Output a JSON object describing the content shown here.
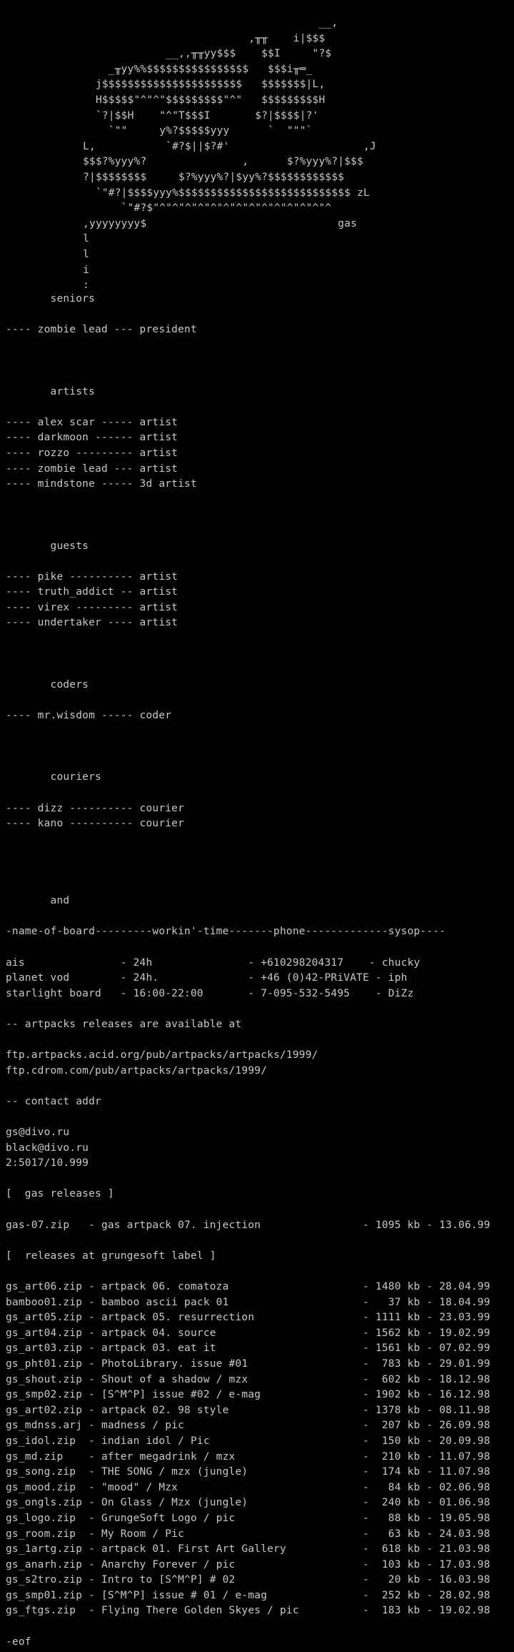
{
  "logo_art": [
    "                                                  __,",
    "                                       ,╥╥    i|$$$",
    "                          __,,╥╥yy$$$    $$I     \"?$",
    "                 _╥yy%%$$$$$$$$$$$$$$$$   $$$i╥═_",
    "               j$$$$$$$$$$$$$$$$$$$$$$   $$$$$$$|L,",
    "               H$$$$$\"^\"^\"$$$$$$$$$\"^\"   $$$$$$$$$H",
    "               `?|$$H    \"^\"T$$$I       $?|$$$$|?'",
    "                 `\"\"     y%?$$$$$yyy      `  \"\"\"`",
    "             L,           `#?$||$?#'                     ,J",
    "             $$$?%yyy%?               ,      $?%yyy%?|$$$",
    "             ?|$$$$$$$$     $?%yyy%?|$yy%?$$$$$$$$$$$$",
    "               `\"#?|$$$$yyy%$$$$$$$$$$$$$$$$$$$$$$$$$$$ zL",
    "                   `\"#?$\"^\"^\"^\"^\"^\"^\"^\"^\"^\"^\"^\"^\"^\"^",
    "             ,yyyyyyyy$                              gas",
    "             l",
    "             l",
    "             i",
    "             :"
  ],
  "sections": {
    "seniors_heading": "       seniors",
    "seniors": [
      "---- zombie lead --- president"
    ],
    "artists_heading": "       artists",
    "artists": [
      "---- alex scar ----- artist",
      "---- darkmoon ------ artist",
      "---- rozzo --------- artist",
      "---- zombie lead --- artist",
      "---- mindstone ----- 3d artist"
    ],
    "guests_heading": "       guests",
    "guests": [
      "---- pike ---------- artist",
      "---- truth_addict -- artist",
      "---- virex --------- artist",
      "---- undertaker ---- artist"
    ],
    "coders_heading": "       coders",
    "coders": [
      "---- mr.wisdom ----- coder"
    ],
    "couriers_heading": "       couriers",
    "couriers": [
      "---- dizz ---------- courier",
      "---- kano ---------- courier"
    ],
    "and_heading": "       and"
  },
  "boards": {
    "header": "-name-of-board---------workin'-time-------phone-------------sysop----",
    "rows": [
      "ais               - 24h               - +610298204317    - chucky",
      "planet vod        - 24h.              - +46 (0)42-PRiVATE - iph",
      "starlight board   - 16:00-22:00       - 7-095-532-5495    - DiZz"
    ]
  },
  "artpacks": {
    "heading": "-- artpacks releases are available at",
    "urls": [
      "ftp.artpacks.acid.org/pub/artpacks/artpacks/1999/",
      "ftp.cdrom.com/pub/artpacks/artpacks/1999/"
    ]
  },
  "contact": {
    "heading": "-- contact addr",
    "lines": [
      "gs@divo.ru",
      "black@divo.ru",
      "2:5017/10.999"
    ]
  },
  "gas_releases": {
    "heading": "[  gas releases ]",
    "rows": [
      "gas-07.zip   - gas artpack 07. injection                - 1095 kb - 13.06.99"
    ]
  },
  "grungesoft_releases": {
    "heading": "[  releases at grungesoft label ]",
    "rows": [
      "gs_art06.zip - artpack 06. comatoza                     - 1480 kb - 28.04.99",
      "bamboo01.zip - bamboo ascii pack 01                     -   37 kb - 18.04.99",
      "gs_art05.zip - artpack 05. resurrection                 - 1111 kb - 23.03.99",
      "gs_art04.zip - artpack 04. source                       - 1562 kb - 19.02.99",
      "gs_art03.zip - artpack 03. eat it                       - 1561 kb - 07.02.99",
      "gs_pht01.zip - PhotoLibrary. issue #01                  -  783 kb - 29.01.99",
      "gs_shout.zip - Shout of a shadow / mzx                  -  602 kb - 18.12.98",
      "gs_smp02.zip - [S^M^P] issue #02 / e-mag                - 1902 kb - 16.12.98",
      "gs_art02.zip - artpack 02. 98 style                     - 1378 kb - 08.11.98",
      "gs_mdnss.arj - madness / pic                            -  207 kb - 26.09.98",
      "gs_idol.zip  - indian idol / Pic                        -  150 kb - 20.09.98",
      "gs_md.zip    - after megadrink / mzx                    -  210 kb - 11.07.98",
      "gs_song.zip  - THE SONG / mzx (jungle)                  -  174 kb - 11.07.98",
      "gs_mood.zip  - \"mood\" / Mzx                             -   84 kb - 02.06.98",
      "gs_ongls.zip - On Glass / Mzx (jungle)                  -  240 kb - 01.06.98",
      "gs_logo.zip  - GrungeSoft Logo / pic                    -   88 kb - 19.05.98",
      "gs_room.zip  - My Room / Pic                            -   63 kb - 24.03.98",
      "gs_1artg.zip - artpack 01. First Art Gallery            -  618 kb - 21.03.98",
      "gs_anarh.zip - Anarchy Forever / pic                    -  103 kb - 17.03.98",
      "gs_s2tro.zip - Intro to [S^M^P] # 02                    -   20 kb - 16.03.98",
      "gs_smp01.zip - [S^M^P] issue # 01 / e-mag               -  252 kb - 28.02.98",
      "gs_ftgs.zip  - Flying There Golden Skyes / pic          -  183 kb - 19.02.98"
    ]
  },
  "footer": "-eof"
}
